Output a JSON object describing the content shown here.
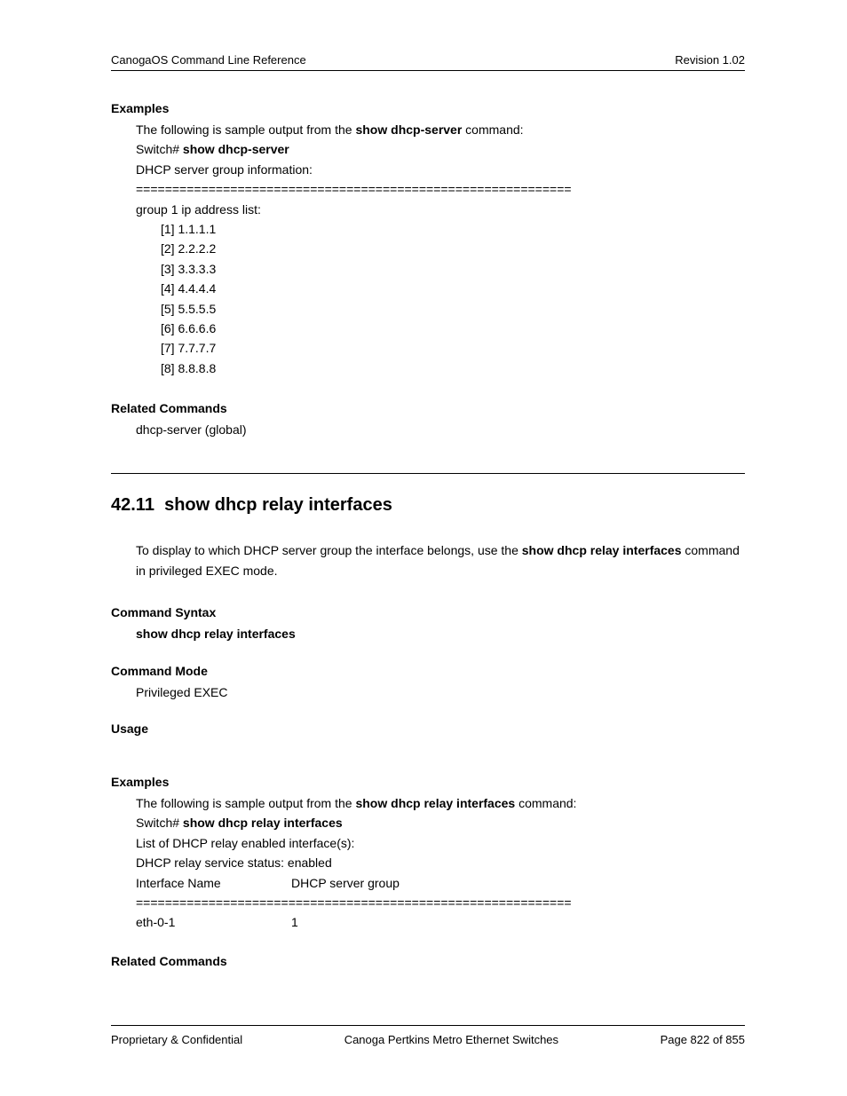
{
  "header": {
    "left": "CanogaOS Command Line Reference",
    "right": "Revision 1.02"
  },
  "examples1": {
    "heading": "Examples",
    "intro_pre": "The following is sample output from the ",
    "intro_cmd": "show dhcp-server",
    "intro_post": " command:",
    "prompt": "Switch# ",
    "prompt_cmd": "show dhcp-server",
    "line1": "DHCP server group information:",
    "divider": "============================================================",
    "group_label": "group 1 ip address list:",
    "ips": [
      "[1] 1.1.1.1",
      "[2] 2.2.2.2",
      "[3] 3.3.3.3",
      "[4] 4.4.4.4",
      "[5] 5.5.5.5",
      "[6] 6.6.6.6",
      "[7] 7.7.7.7",
      "[8] 8.8.8.8"
    ]
  },
  "related1": {
    "heading": "Related Commands",
    "cmd": "dhcp-server (global)"
  },
  "section": {
    "number": "42.11",
    "title": "show dhcp relay interfaces",
    "desc_pre": "To display to which DHCP server group the interface belongs, use the ",
    "desc_cmd": "show dhcp relay interfaces",
    "desc_post": " command in privileged EXEC mode."
  },
  "syntax": {
    "heading": "Command Syntax",
    "value": "show dhcp relay interfaces"
  },
  "mode": {
    "heading": "Command Mode",
    "value": "Privileged EXEC"
  },
  "usage": {
    "heading": "Usage"
  },
  "examples2": {
    "heading": "Examples",
    "intro_pre": "The following is sample output from the ",
    "intro_cmd": "show dhcp relay interfaces",
    "intro_post": " command:",
    "prompt": "Switch# ",
    "prompt_cmd": "show dhcp relay interfaces",
    "line1": "List of DHCP relay enabled interface(s):",
    "line2": "DHCP relay service status: enabled",
    "col1": "Interface Name",
    "col2": "DHCP server group",
    "divider": "============================================================",
    "row_col1": "eth-0-1",
    "row_col2": "1"
  },
  "related2": {
    "heading": "Related Commands"
  },
  "footer": {
    "left": "Proprietary & Confidential",
    "center": "Canoga Pertkins Metro Ethernet Switches",
    "right": "Page 822 of 855"
  }
}
